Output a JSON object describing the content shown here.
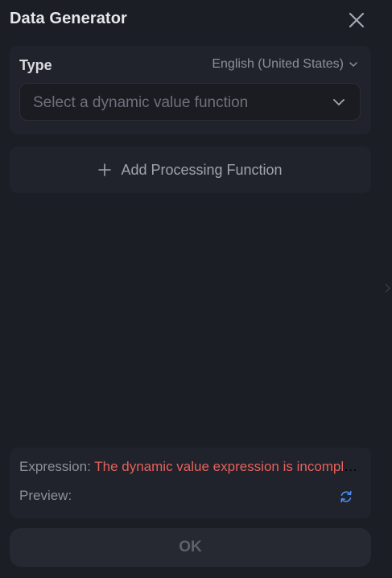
{
  "header": {
    "title": "Data Generator",
    "close_icon": "close-icon"
  },
  "type_section": {
    "label": "Type",
    "locale": "English (United States)",
    "select_placeholder": "Select a dynamic value function"
  },
  "processing": {
    "add_label": "Add Processing Function",
    "icon": "plus-icon"
  },
  "expression": {
    "key": "Expression:",
    "value": "The dynamic value expression is incomplete",
    "preview_key": "Preview:",
    "refresh_icon": "refresh-icon"
  },
  "footer": {
    "ok_label": "OK"
  },
  "colors": {
    "background": "#1c1e25",
    "card": "#20232b",
    "error_text": "#e5615c",
    "accent_icon": "#4b8ef0"
  }
}
